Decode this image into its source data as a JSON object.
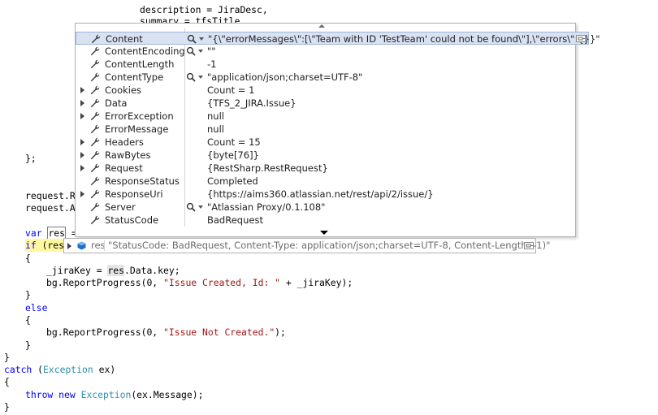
{
  "code": {
    "l1_a": "description = JiraDesc,",
    "l2_a": "summary = tfsTitle",
    "l3": "};",
    "l4": "request.Re",
    "l5": "request.Ad",
    "l6_kw": "var",
    "l6_res": "res",
    "l6_eq": " =",
    "l7_kw": "if",
    "l7_rest": " (res",
    "l8": "{",
    "l9_a": "_jiraKey = ",
    "l9_res": "res",
    "l9_b": ".Data.key;",
    "l10_a": "bg.ReportProgress(0, ",
    "l10_str": "\"Issue Created, Id: \"",
    "l10_b": " + _jiraKey);",
    "l11": "}",
    "l12": "else",
    "l13": "{",
    "l14_a": "bg.ReportProgress(0, ",
    "l14_str": "\"Issue Not Created.\"",
    "l14_b": ");",
    "l15": "}",
    "l16": "}",
    "l17_kw": "catch",
    "l17_a": " (",
    "l17_type": "Exception",
    "l17_b": " ex)",
    "l18": "{",
    "l19_kw1": "throw",
    "l19_kw2": "new",
    "l19_type": "Exception",
    "l19_b": "(ex.Message);",
    "l20": "}"
  },
  "datatip": {
    "rows": [
      {
        "name": "Content",
        "value": "\"{\\\"errorMessages\\\":[\\\"Team with ID 'TestTeam' could not be found\\\"],\\\"errors\\\":{}}\""
      },
      {
        "name": "ContentEncoding",
        "value": "\"\""
      },
      {
        "name": "ContentLength",
        "value": "-1"
      },
      {
        "name": "ContentType",
        "value": "\"application/json;charset=UTF-8\""
      },
      {
        "name": "Cookies",
        "value": "Count = 1"
      },
      {
        "name": "Data",
        "value": "{TFS_2_JIRA.Issue}"
      },
      {
        "name": "ErrorException",
        "value": "null"
      },
      {
        "name": "ErrorMessage",
        "value": "null"
      },
      {
        "name": "Headers",
        "value": "Count = 15"
      },
      {
        "name": "RawBytes",
        "value": "{byte[76]}"
      },
      {
        "name": "Request",
        "value": "{RestSharp.RestRequest}"
      },
      {
        "name": "ResponseStatus",
        "value": "Completed"
      },
      {
        "name": "ResponseUri",
        "value": "{https://aims360.atlassian.net/rest/api/2/issue/}"
      },
      {
        "name": "Server",
        "value": "\"Atlassian Proxy/0.1.108\""
      },
      {
        "name": "StatusCode",
        "value": "BadRequest"
      }
    ]
  },
  "res_tip": {
    "name": "res",
    "value": "\"StatusCode: BadRequest, Content-Type: application/json;charset=UTF-8, Content-Length: -1)\""
  },
  "colors": {
    "keyword": "#0000ff",
    "string": "#a31515",
    "type": "#2b91af",
    "selected_row": "#d9e2f2",
    "highlight": "#fff8a0"
  }
}
